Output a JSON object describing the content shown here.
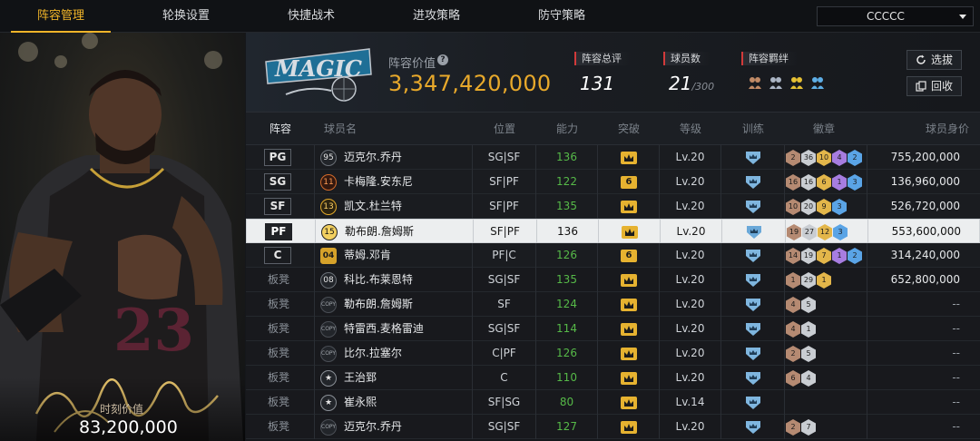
{
  "nav": {
    "tabs": [
      {
        "label": "阵容管理",
        "active": true
      },
      {
        "label": "轮换设置",
        "active": false
      },
      {
        "label": "快捷战术",
        "active": false
      },
      {
        "label": "进攻策略",
        "active": false
      },
      {
        "label": "防守策略",
        "active": false
      }
    ],
    "lineup_select": "CCCCC"
  },
  "player_card": {
    "moment_value_label": "时刻价值",
    "moment_value": "83,200,000",
    "jersey_number": "23"
  },
  "team": {
    "logo_text": "MAGIC",
    "lineup_value_label": "阵容价值",
    "lineup_value": "3,347,420,000",
    "overall_label": "阵容总评",
    "overall_value": "131",
    "count_label": "球员数",
    "count_value": "21",
    "count_max": "/300",
    "bond_label": "阵容羁绊",
    "buttons": {
      "select": "选拔",
      "recycle": "回收"
    }
  },
  "table": {
    "headers": [
      "阵容",
      "球员名",
      "位置",
      "能力",
      "突破",
      "等级",
      "训练",
      "徽章",
      "球员身价"
    ],
    "rows": [
      {
        "slot": "PG",
        "badge": "95",
        "badge_type": "plain",
        "name": "迈克尔.乔丹",
        "position": "SG|SF",
        "ability": "136",
        "breakthrough": "crown",
        "level": "Lv.20",
        "chips": [
          [
            "2",
            "br"
          ],
          [
            "36",
            "sv"
          ],
          [
            "10",
            "gd"
          ],
          [
            "4",
            "pu"
          ],
          [
            "2",
            "bl"
          ]
        ],
        "value": "755,200,000"
      },
      {
        "slot": "SG",
        "badge": "11",
        "badge_type": "red",
        "name": "卡梅隆.安东尼",
        "position": "SF|PF",
        "ability": "122",
        "breakthrough": "6",
        "level": "Lv.20",
        "chips": [
          [
            "16",
            "br"
          ],
          [
            "16",
            "sv"
          ],
          [
            "6",
            "gd"
          ],
          [
            "1",
            "pu"
          ],
          [
            "3",
            "bl"
          ]
        ],
        "value": "136,960,000"
      },
      {
        "slot": "SF",
        "badge": "13",
        "badge_type": "gold",
        "name": "凯文.杜兰特",
        "position": "SF|PF",
        "ability": "135",
        "breakthrough": "crown",
        "level": "Lv.20",
        "chips": [
          [
            "10",
            "br"
          ],
          [
            "20",
            "sv"
          ],
          [
            "9",
            "gd"
          ],
          [
            "3",
            "bl"
          ]
        ],
        "value": "526,720,000"
      },
      {
        "slot": "PF",
        "badge": "15",
        "badge_type": "gold",
        "name": "勒布朗.詹姆斯",
        "position": "SF|PF",
        "ability": "136",
        "breakthrough": "crown",
        "level": "Lv.20",
        "chips": [
          [
            "19",
            "br"
          ],
          [
            "27",
            "sv"
          ],
          [
            "12",
            "gd"
          ],
          [
            "3",
            "bl"
          ]
        ],
        "value": "553,600,000",
        "selected": true
      },
      {
        "slot": "C",
        "badge": "04",
        "badge_type": "gold4",
        "name": "蒂姆.邓肯",
        "position": "PF|C",
        "ability": "126",
        "breakthrough": "6",
        "level": "Lv.20",
        "chips": [
          [
            "14",
            "br"
          ],
          [
            "19",
            "sv"
          ],
          [
            "7",
            "gd"
          ],
          [
            "1",
            "pu"
          ],
          [
            "2",
            "bl"
          ]
        ],
        "value": "314,240,000"
      },
      {
        "slot": "板凳",
        "badge": "08",
        "badge_type": "plain",
        "name": "科比.布莱恩特",
        "position": "SG|SF",
        "ability": "135",
        "breakthrough": "crown",
        "level": "Lv.20",
        "chips": [
          [
            "1",
            "br"
          ],
          [
            "29",
            "sv"
          ],
          [
            "1",
            "gd"
          ]
        ],
        "value": "652,800,000"
      },
      {
        "slot": "板凳",
        "badge": "COPY",
        "badge_type": "copy",
        "name": "勒布朗.詹姆斯",
        "position": "SF",
        "ability": "124",
        "breakthrough": "crown",
        "level": "Lv.20",
        "chips": [
          [
            "4",
            "br"
          ],
          [
            "5",
            "sv"
          ]
        ],
        "value": "--"
      },
      {
        "slot": "板凳",
        "badge": "COPY",
        "badge_type": "copy",
        "name": "特雷西.麦格雷迪",
        "position": "SG|SF",
        "ability": "114",
        "breakthrough": "crown",
        "level": "Lv.20",
        "chips": [
          [
            "4",
            "br"
          ],
          [
            "1",
            "sv"
          ]
        ],
        "value": "--"
      },
      {
        "slot": "板凳",
        "badge": "COPY",
        "badge_type": "copy",
        "name": "比尔.拉塞尔",
        "position": "C|PF",
        "ability": "126",
        "breakthrough": "crown",
        "level": "Lv.20",
        "chips": [
          [
            "2",
            "br"
          ],
          [
            "5",
            "sv"
          ]
        ],
        "value": "--"
      },
      {
        "slot": "板凳",
        "badge": "★",
        "badge_type": "star",
        "name": "王治郅",
        "position": "C",
        "ability": "110",
        "breakthrough": "crown",
        "level": "Lv.20",
        "chips": [
          [
            "6",
            "br"
          ],
          [
            "4",
            "sv"
          ]
        ],
        "value": "--"
      },
      {
        "slot": "板凳",
        "badge": "★",
        "badge_type": "star",
        "name": "崔永熙",
        "position": "SF|SG",
        "ability": "80",
        "breakthrough": "crown",
        "level": "Lv.14",
        "chips": [],
        "value": "--"
      },
      {
        "slot": "板凳",
        "badge": "COPY",
        "badge_type": "copy",
        "name": "迈克尔.乔丹",
        "position": "SG|SF",
        "ability": "127",
        "breakthrough": "crown",
        "level": "Lv.20",
        "chips": [
          [
            "2",
            "br"
          ],
          [
            "7",
            "sv"
          ]
        ],
        "value": "--"
      }
    ]
  },
  "colors": {
    "accent": "#f0b429",
    "value_gold": "#e8a92b",
    "ability_green": "#56b948",
    "stat_red": "#d23a3a"
  }
}
